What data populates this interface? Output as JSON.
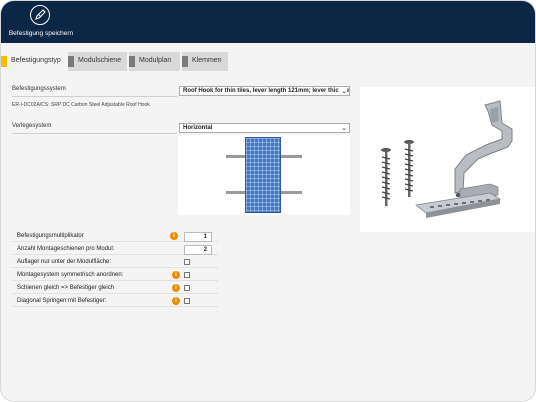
{
  "header": {
    "save_label": "Befestigung speichern",
    "save_icon": "save-pencil-icon",
    "background": "#0c2646"
  },
  "tabs": [
    {
      "label": "Befestigungstyp",
      "active": true
    },
    {
      "label": "Modulschiene",
      "active": false
    },
    {
      "label": "Modulplan",
      "active": false
    },
    {
      "label": "Klemmen",
      "active": false
    }
  ],
  "fastening": {
    "section_label": "Befestigungssystem",
    "selected": "Roof Hook for thin tiles, lever length 121mm; lever thickne",
    "description": "ER-I-DC02A/CS: SRP DC Carbon Steel Adjustable Roof Hook"
  },
  "laying": {
    "section_label": "Verlegesystem",
    "selected": "Horizontal"
  },
  "properties": {
    "multiplier": {
      "label": "Befestigungsmultiplikator",
      "value": "1"
    },
    "rails_per_module": {
      "label": "Anzahl Montageschienen pro Modul:",
      "value": "2"
    },
    "support_under_module": {
      "label": "Auflager nur unter der Modulfläche:"
    },
    "symmetric": {
      "label": "Montagesystem symmetrisch anordnen:"
    },
    "rails_equal": {
      "label": "Schienen gleich => Befestiger gleich"
    },
    "diagonal": {
      "label": "Diagonal Springen mit Befestiger:"
    }
  },
  "colors": {
    "accent": "#f2c200",
    "info": "#f08a00",
    "panel": "#3f78c8"
  }
}
